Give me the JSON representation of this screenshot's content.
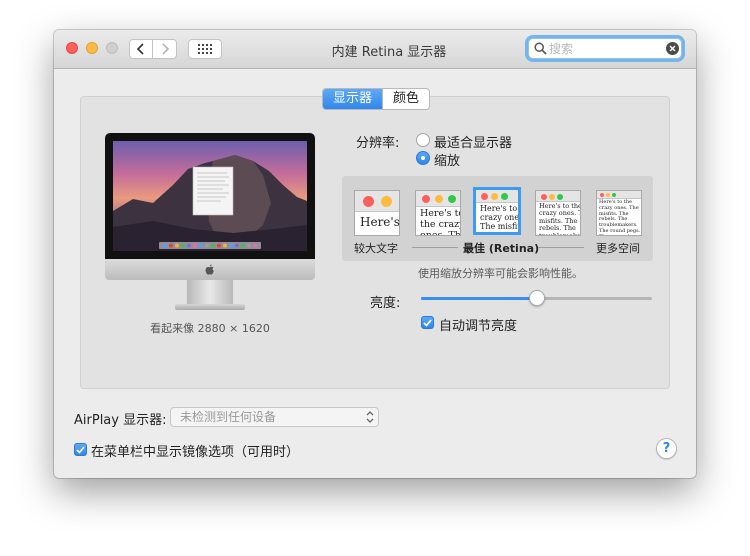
{
  "window": {
    "title": "内建 Retina 显示器",
    "search": {
      "placeholder": "搜索",
      "value": ""
    }
  },
  "tabs": [
    {
      "label": "显示器",
      "selected": true
    },
    {
      "label": "颜色",
      "selected": false
    }
  ],
  "display": {
    "looks_like": "看起来像 2880 × 1620",
    "resolution_label": "分辨率:",
    "resolution_options": [
      {
        "label": "最适合显示器",
        "selected": false
      },
      {
        "label": "缩放",
        "selected": true
      }
    ],
    "scale_thumb_text": "Here's to the crazy ones. The misfits. The rebels. The troublemakers. The round pegs. The ones who see things differently.",
    "scale_labels": {
      "larger": "较大文字",
      "best": "最佳 (Retina)",
      "more": "更多空间"
    },
    "selected_scale_index": 2,
    "note": "使用缩放分辨率可能会影响性能。",
    "brightness_label": "亮度:",
    "brightness": 0.5,
    "auto_brightness_label": "自动调节亮度",
    "auto_brightness": true
  },
  "airplay": {
    "label": "AirPlay 显示器:",
    "value": "未检测到任何设备"
  },
  "mirroring": {
    "label": "在菜单栏中显示镜像选项（可用时）",
    "checked": true
  },
  "help_symbol": "?",
  "colors": {
    "accent": "#2f86eb",
    "close": "#fc605c",
    "minimize": "#fdbc40",
    "zoom_disabled": "#cfcfcf"
  }
}
